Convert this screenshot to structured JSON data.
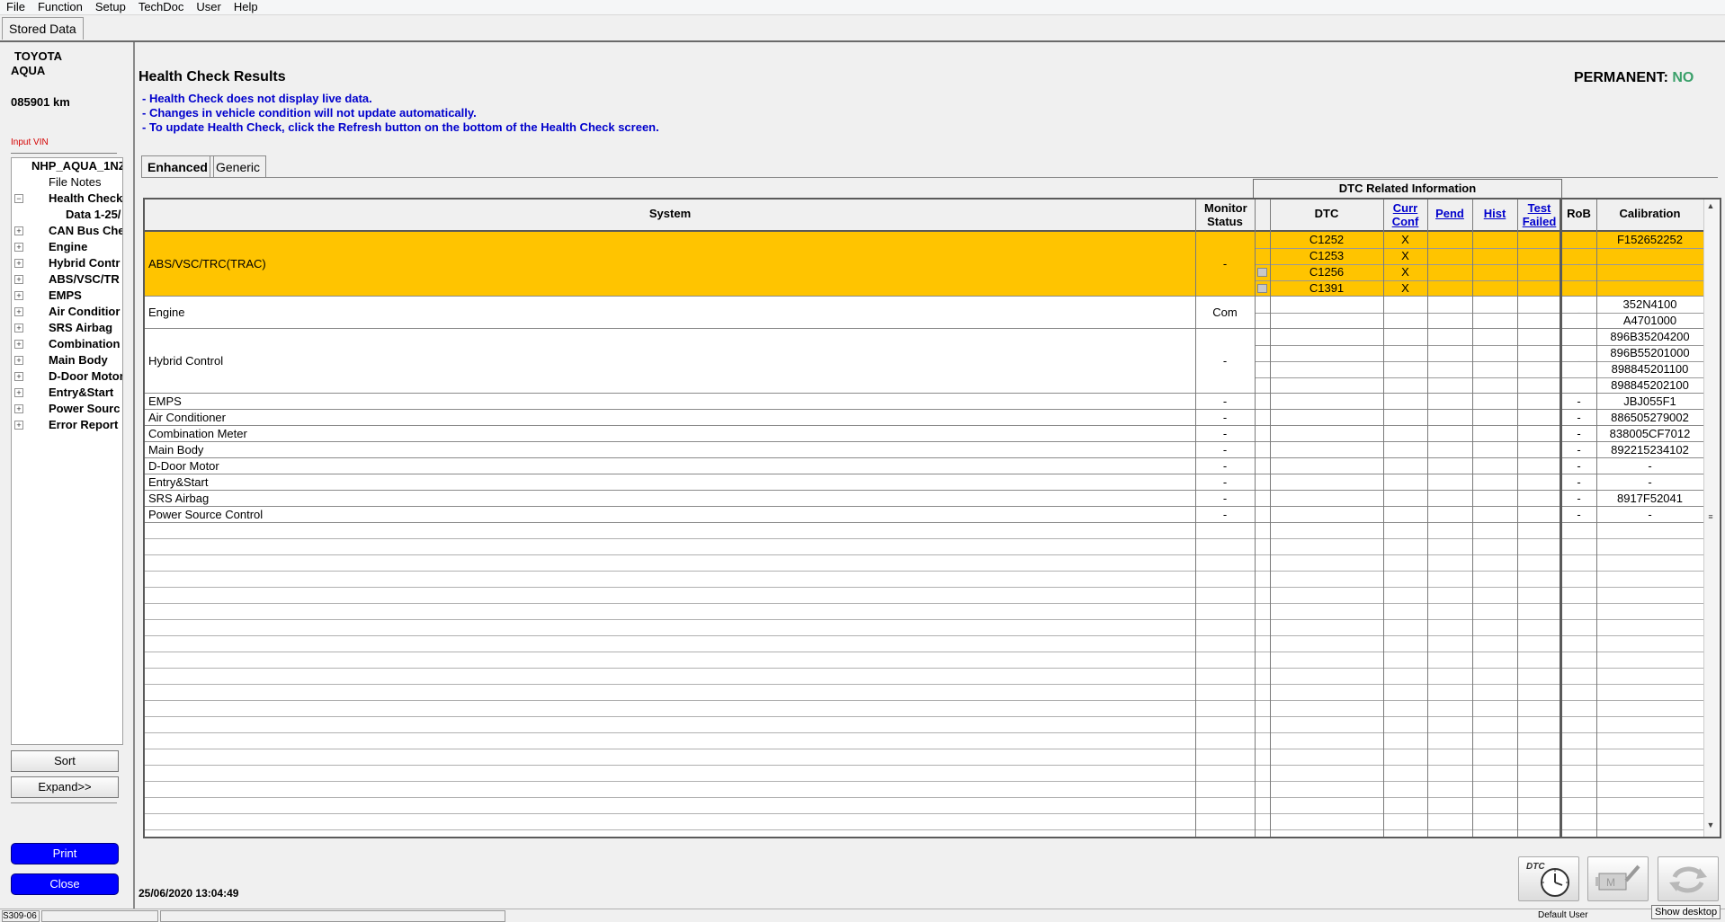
{
  "menu": [
    "File",
    "Function",
    "Setup",
    "TechDoc",
    "User",
    "Help"
  ],
  "top_tab": "Stored Data",
  "vehicle": {
    "make": "TOYOTA",
    "model": "AQUA",
    "odometer": "085901 km",
    "input_vin": "Input VIN"
  },
  "tree": [
    {
      "label": "NHP_AQUA_1NZ",
      "level": 0,
      "toggle": ""
    },
    {
      "label": "File Notes",
      "level": 1,
      "toggle": ""
    },
    {
      "label": "Health Check",
      "level": 1,
      "toggle": "−",
      "bold": true
    },
    {
      "label": "Data 1-25/",
      "level": 2,
      "toggle": "",
      "bold": true
    },
    {
      "label": "CAN Bus Che",
      "level": 1,
      "toggle": "+",
      "bold": true
    },
    {
      "label": "Engine",
      "level": 1,
      "toggle": "+",
      "bold": true
    },
    {
      "label": "Hybrid Contr",
      "level": 1,
      "toggle": "+",
      "bold": true
    },
    {
      "label": "ABS/VSC/TR",
      "level": 1,
      "toggle": "+",
      "bold": true
    },
    {
      "label": "EMPS",
      "level": 1,
      "toggle": "+",
      "bold": true
    },
    {
      "label": "Air Conditior",
      "level": 1,
      "toggle": "+",
      "bold": true
    },
    {
      "label": "SRS Airbag",
      "level": 1,
      "toggle": "+",
      "bold": true
    },
    {
      "label": "Combination",
      "level": 1,
      "toggle": "+",
      "bold": true
    },
    {
      "label": "Main Body",
      "level": 1,
      "toggle": "+",
      "bold": true
    },
    {
      "label": "D-Door Motor",
      "level": 1,
      "toggle": "+",
      "bold": true
    },
    {
      "label": "Entry&Start",
      "level": 1,
      "toggle": "+",
      "bold": true
    },
    {
      "label": "Power Sourc",
      "level": 1,
      "toggle": "+",
      "bold": true
    },
    {
      "label": "Error Report",
      "level": 1,
      "toggle": "+",
      "bold": true
    }
  ],
  "left_buttons": {
    "sort": "Sort",
    "expand": "Expand>>",
    "print": "Print",
    "close": "Close"
  },
  "main": {
    "title": "Health Check Results",
    "permanent_label": "PERMANENT:",
    "permanent_value": "NO",
    "messages": [
      "- Health Check does not display live data.",
      "- Changes in vehicle condition will not update automatically.",
      "- To update Health Check, click the Refresh button on the bottom of the Health Check screen."
    ],
    "tabs": [
      "Enhanced",
      "Generic"
    ],
    "dtc_related_info": "DTC Related Information",
    "timestamp": "25/06/2020 13:04:49"
  },
  "table": {
    "headers": {
      "system": "System",
      "monitor": "Monitor Status",
      "dtc": "DTC",
      "curr": "Curr Conf",
      "pend": "Pend",
      "hist": "Hist",
      "test": "Test Failed",
      "rob": "RoB",
      "calibration": "Calibration"
    },
    "groups": [
      {
        "system": "ABS/VSC/TRC(TRAC)",
        "monitor": "-",
        "rob": "-",
        "highlight": true,
        "subrows": [
          {
            "icon": false,
            "dtc": "C1252",
            "curr": "X",
            "cal": "F152652252"
          },
          {
            "icon": false,
            "dtc": "C1253",
            "curr": "X",
            "cal": ""
          },
          {
            "icon": true,
            "dtc": "C1256",
            "curr": "X",
            "cal": ""
          },
          {
            "icon": true,
            "dtc": "C1391",
            "curr": "X",
            "cal": ""
          }
        ]
      },
      {
        "system": "Engine",
        "monitor": "Com",
        "rob": "-",
        "subrows": [
          {
            "dtc": "",
            "curr": "",
            "cal": "352N4100"
          },
          {
            "dtc": "",
            "curr": "",
            "cal": "A4701000"
          }
        ]
      },
      {
        "system": "Hybrid Control",
        "monitor": "-",
        "rob": "-",
        "subrows": [
          {
            "dtc": "",
            "curr": "",
            "cal": "896B35204200"
          },
          {
            "dtc": "",
            "curr": "",
            "cal": "896B55201000"
          },
          {
            "dtc": "",
            "curr": "",
            "cal": "898845201100"
          },
          {
            "dtc": "",
            "curr": "",
            "cal": "898845202100"
          }
        ]
      },
      {
        "system": "EMPS",
        "monitor": "-",
        "rob": "-",
        "subrows": [
          {
            "dtc": "",
            "curr": "",
            "cal": "JBJ055F1"
          }
        ]
      },
      {
        "system": "Air Conditioner",
        "monitor": "-",
        "rob": "-",
        "subrows": [
          {
            "dtc": "",
            "curr": "",
            "cal": "886505279002"
          }
        ]
      },
      {
        "system": "Combination Meter",
        "monitor": "-",
        "rob": "-",
        "subrows": [
          {
            "dtc": "",
            "curr": "",
            "cal": "838005CF7012"
          }
        ]
      },
      {
        "system": "Main Body",
        "monitor": "-",
        "rob": "-",
        "subrows": [
          {
            "dtc": "",
            "curr": "",
            "cal": "892215234102"
          }
        ]
      },
      {
        "system": "D-Door Motor",
        "monitor": "-",
        "rob": "-",
        "subrows": [
          {
            "dtc": "",
            "curr": "",
            "cal": "-"
          }
        ]
      },
      {
        "system": "Entry&Start",
        "monitor": "-",
        "rob": "-",
        "subrows": [
          {
            "dtc": "",
            "curr": "",
            "cal": "-"
          }
        ]
      },
      {
        "system": "SRS Airbag",
        "monitor": "-",
        "rob": "-",
        "subrows": [
          {
            "dtc": "",
            "curr": "",
            "cal": "8917F52041"
          }
        ]
      },
      {
        "system": "Power Source Control",
        "monitor": "-",
        "rob": "-",
        "subrows": [
          {
            "dtc": "",
            "curr": "",
            "cal": "-"
          }
        ]
      }
    ]
  },
  "icons": [
    "dtc-clock-icon",
    "engine-icon",
    "refresh-icon"
  ],
  "dtc_icon_label": "DTC",
  "status": {
    "left": "S309-06",
    "user": "Default User",
    "show_desktop": "Show desktop"
  },
  "colors": {
    "highlight": "#ffc400",
    "link": "#0000cc",
    "permanent_ok": "#3aa06a",
    "button_blue": "#0000ff"
  }
}
